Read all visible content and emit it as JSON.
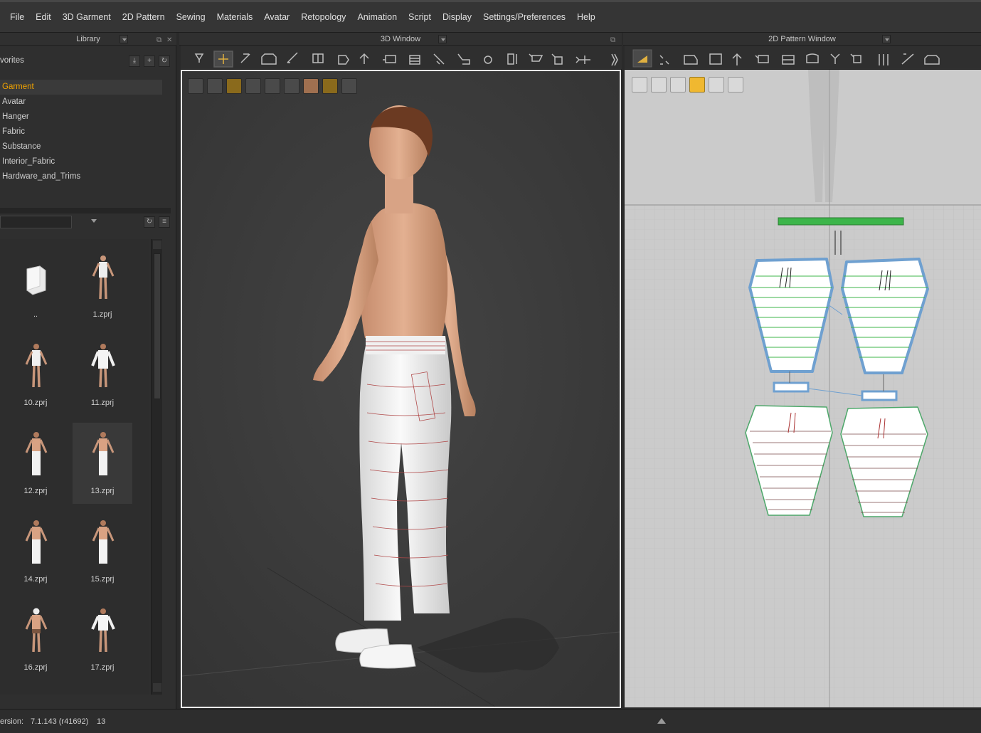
{
  "menu": [
    "File",
    "Edit",
    "3D Garment",
    "2D Pattern",
    "Sewing",
    "Materials",
    "Avatar",
    "Retopology",
    "Animation",
    "Script",
    "Display",
    "Settings/Preferences",
    "Help"
  ],
  "panels": {
    "library_title": "Library",
    "view3d_title": "3D Window",
    "view2d_title": "2D Pattern Window"
  },
  "library": {
    "favorites_label": "vorites",
    "tree": [
      "Garment",
      "Avatar",
      "Hanger",
      "Fabric",
      "Substance",
      "Interior_Fabric",
      "Hardware_and_Trims"
    ],
    "active_tree_item": "Garment",
    "search_value": "",
    "files": [
      "..",
      "1.zprj",
      "10.zprj",
      "11.zprj",
      "12.zprj",
      "13.zprj",
      "14.zprj",
      "15.zprj",
      "16.zprj",
      "17.zprj"
    ],
    "selected_file": "13.zprj"
  },
  "status": {
    "version_label": "ersion:",
    "version_value": "7.1.143 (r41692)",
    "count": "13"
  },
  "colors": {
    "accent": "#f0a200",
    "selected_pattern_outline": "#6fa0d0",
    "seam_green": "#3cb54a",
    "viewport_bg": "#3b3b3b",
    "pattern_bg": "#cbcbcb"
  }
}
